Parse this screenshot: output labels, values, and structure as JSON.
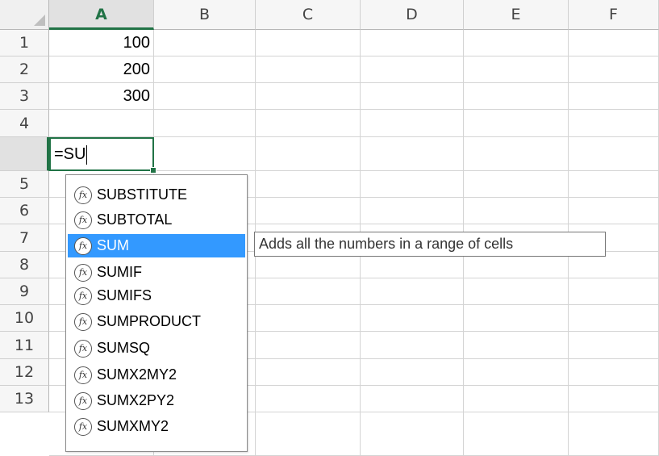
{
  "columns": [
    "A",
    "B",
    "C",
    "D",
    "E",
    "F"
  ],
  "selected_column": "A",
  "rows": [
    "1",
    "2",
    "3",
    "4",
    "5",
    "6",
    "7",
    "8",
    "9",
    "10",
    "11",
    "12",
    "13"
  ],
  "selected_row": "4",
  "cells": {
    "A1": "100",
    "A2": "200",
    "A3": "300",
    "A4": "=SU"
  },
  "autocomplete": {
    "icon_glyph": "fx",
    "items": [
      "SUBSTITUTE",
      "SUBTOTAL",
      "SUM",
      "SUMIF",
      "SUMIFS",
      "SUMPRODUCT",
      "SUMSQ",
      "SUMX2MY2",
      "SUMX2PY2",
      "SUMXMY2"
    ],
    "selected_index": 2
  },
  "tooltip": "Adds all the numbers in a range of cells",
  "colors": {
    "accent_green": "#217346",
    "selection_blue": "#3399ff"
  }
}
